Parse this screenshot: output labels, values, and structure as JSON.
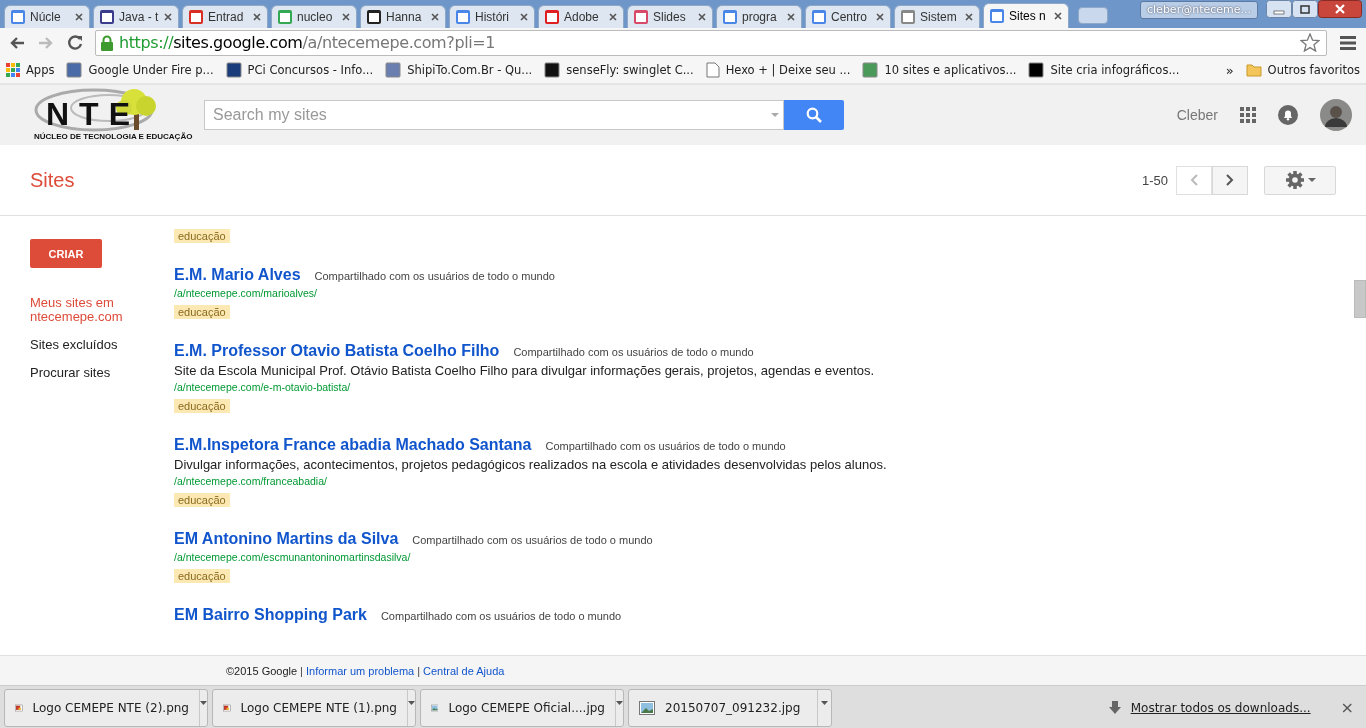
{
  "browser": {
    "tabs": [
      {
        "title": "Núcle",
        "selected": false
      },
      {
        "title": "Java - t",
        "selected": false
      },
      {
        "title": "Entrad",
        "selected": false
      },
      {
        "title": "nucleo",
        "selected": false
      },
      {
        "title": "Hanna",
        "selected": false
      },
      {
        "title": "Históri",
        "selected": false
      },
      {
        "title": "Adobe",
        "selected": false
      },
      {
        "title": "Slides",
        "selected": false
      },
      {
        "title": "progra",
        "selected": false
      },
      {
        "title": "Centro",
        "selected": false
      },
      {
        "title": "Sistem",
        "selected": false
      },
      {
        "title": "Sites n",
        "selected": true
      }
    ],
    "profile": "cleber@nteceme...",
    "url": {
      "scheme": "https://",
      "host": "sites.google.com",
      "path": "/a/ntecemepe.com?pli=1"
    },
    "bookmarks": [
      {
        "title": "Apps",
        "kind": "apps"
      },
      {
        "title": "Google Under Fire p...",
        "kind": "site"
      },
      {
        "title": "PCi Concursos - Info...",
        "kind": "site"
      },
      {
        "title": "ShipiTo.Com.Br - Qu...",
        "kind": "site"
      },
      {
        "title": "senseFly: swinglet C...",
        "kind": "site"
      },
      {
        "title": "Hexo + | Deixe seu ...",
        "kind": "page"
      },
      {
        "title": "10 sites e aplicativos...",
        "kind": "site"
      },
      {
        "title": "Site cria infográficos...",
        "kind": "site"
      }
    ],
    "bookmarks_more": "»",
    "other_bookmarks": "Outros favoritos"
  },
  "header": {
    "logo": {
      "letters": "NTE",
      "subtitle": "NÚCLEO DE TECNOLOGIA E EDUCAÇÃO"
    },
    "search": {
      "placeholder": "Search my sites"
    },
    "user": "Cleber"
  },
  "toolbar": {
    "title": "Sites",
    "range": "1-50",
    "prev_disabled": true
  },
  "sidebar": {
    "create": "CRIAR",
    "items": [
      {
        "label": "Meus sites em ntecemepe.com",
        "selected": true
      },
      {
        "label": "Sites excluídos",
        "selected": false
      },
      {
        "label": "Procurar sites",
        "selected": false
      }
    ]
  },
  "sites": [
    {
      "tags": [
        "educação"
      ]
    },
    {
      "title": "E.M. Mario Alves",
      "sharing": "Compartilhado com os usuários de todo o mundo",
      "url": "/a/ntecemepe.com/marioalves/",
      "tags": [
        "educação"
      ]
    },
    {
      "title": "E.M. Professor Otavio Batista Coelho Filho",
      "sharing": "Compartilhado com os usuários de todo o mundo",
      "description": "Site da Escola Municipal Prof. Otávio Batista Coelho Filho para divulgar informações gerais, projetos, agendas e eventos.",
      "url": "/a/ntecemepe.com/e-m-otavio-batista/",
      "tags": [
        "educação"
      ]
    },
    {
      "title": "E.M.Inspetora France abadia Machado Santana",
      "sharing": "Compartilhado com os usuários de todo o mundo",
      "description": "Divulgar informações, acontecimentos, projetos pedagógicos realizados na escola e atividades desenvolvidas pelos alunos.",
      "url": "/a/ntecemepe.com/franceabadia/",
      "tags": [
        "educação"
      ]
    },
    {
      "title": "EM Antonino Martins da Silva",
      "sharing": "Compartilhado com os usuários de todo o mundo",
      "url": "/a/ntecemepe.com/escmunantoninomartinsdasilva/",
      "tags": [
        "educação"
      ]
    },
    {
      "title": "EM Bairro Shopping Park",
      "sharing": "Compartilhado com os usuários de todo o mundo"
    }
  ],
  "footer": {
    "copyright": "©2015 Google",
    "separator": "|",
    "links": [
      "Informar um problema",
      "Central de Ajuda"
    ]
  },
  "downloads": {
    "items": [
      {
        "name": "Logo CEMEPE NTE (2).png",
        "kind": "png"
      },
      {
        "name": "Logo CEMEPE NTE (1).png",
        "kind": "png"
      },
      {
        "name": "Logo CEMEPE Oficial....jpg",
        "kind": "jpg"
      },
      {
        "name": "20150707_091232.jpg",
        "kind": "jpg"
      }
    ],
    "show_all": "Mostrar todos os downloads...",
    "close": "×"
  }
}
